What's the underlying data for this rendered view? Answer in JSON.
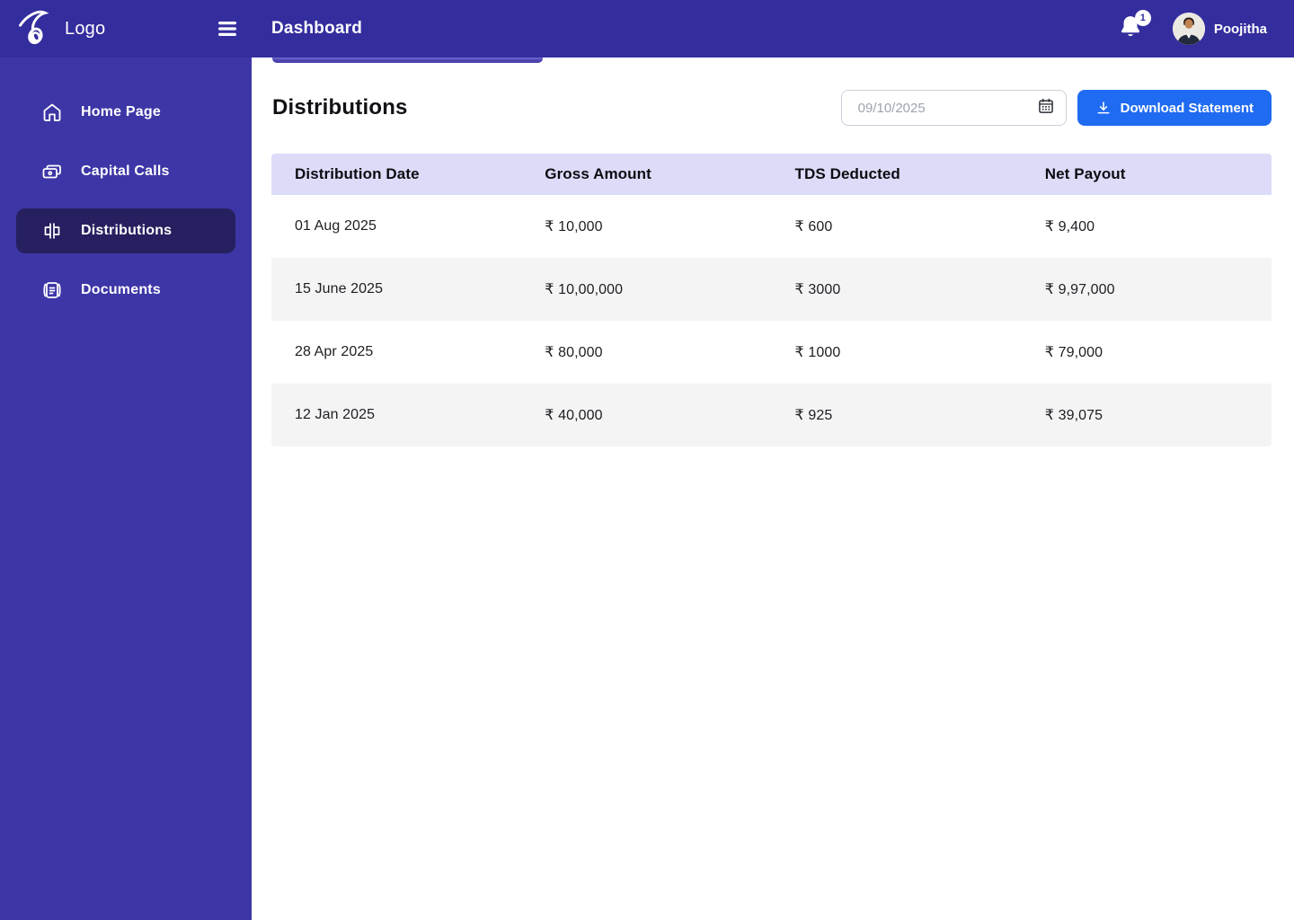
{
  "header": {
    "logo_text": "Logo",
    "page_title": "Dashboard",
    "notifications": {
      "count": "1"
    },
    "user": {
      "name": "Poojitha"
    }
  },
  "sidebar": {
    "items": [
      {
        "label": "Home Page",
        "active": false
      },
      {
        "label": "Capital Calls",
        "active": false
      },
      {
        "label": "Distributions",
        "active": true
      },
      {
        "label": "Documents",
        "active": false
      }
    ]
  },
  "main": {
    "heading": "Distributions",
    "date_filter": {
      "value": "09/10/2025"
    },
    "download_button": {
      "label": "Download Statement"
    },
    "table": {
      "columns": [
        "Distribution Date",
        "Gross Amount",
        "TDS Deducted",
        "Net Payout"
      ],
      "rows": [
        [
          "01 Aug 2025",
          "₹ 10,000",
          "₹ 600",
          "₹ 9,400"
        ],
        [
          "15 June 2025",
          "₹ 10,00,000",
          "₹ 3000",
          "₹ 9,97,000"
        ],
        [
          "28 Apr 2025",
          "₹ 80,000",
          "₹ 1000",
          "₹ 79,000"
        ],
        [
          "12 Jan 2025",
          "₹ 40,000",
          "₹ 925",
          "₹ 39,075"
        ]
      ]
    }
  },
  "colors": {
    "header_bg": "#342D9E",
    "sidebar_bg": "#3D36A6",
    "active_item_bg": "#262060",
    "accent_blue": "#1F6BF2",
    "table_header_bg": "#DCDCF8",
    "row_alt_bg": "#F4F4F5"
  }
}
